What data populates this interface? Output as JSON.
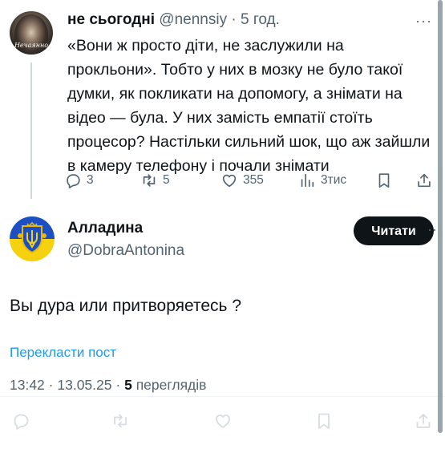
{
  "reply_tweet": {
    "author_name": "не сьогодні",
    "handle": "@nennsiy",
    "separator": "·",
    "time": "5 год.",
    "avatar_signature": "Нечаянно",
    "text": "«Вони ж просто діти, не заслужили на прокльони». Тобто у них в мозку не було такої думки, як покликати на допомогу, а знімати на відео — була. У них замість емпатії стоїть процесор? Настільки сильний шок, що аж зайшли в камеру телефону і почали знімати",
    "more": "···",
    "actions": {
      "replies": "3",
      "reposts": "5",
      "likes": "355",
      "views": "3тис"
    }
  },
  "main_tweet": {
    "author_name": "Алладина",
    "handle": "@DobraAntonina",
    "follow_label": "Читати",
    "more": "···",
    "text": "Вы дура или притворяетесь ?",
    "translate_label": "Перекласти пост",
    "time": "13:42",
    "date": "13.05.25",
    "views_count": "5",
    "views_label": "переглядів",
    "separator": "·"
  },
  "colors": {
    "text": "#0f1419",
    "secondary": "#536471",
    "link": "#1d9bf0",
    "follow_bg": "#0f1419",
    "divider": "#eff3f4"
  },
  "icons": [
    "reply-icon",
    "repost-icon",
    "like-icon",
    "views-icon",
    "bookmark-icon",
    "share-icon"
  ]
}
